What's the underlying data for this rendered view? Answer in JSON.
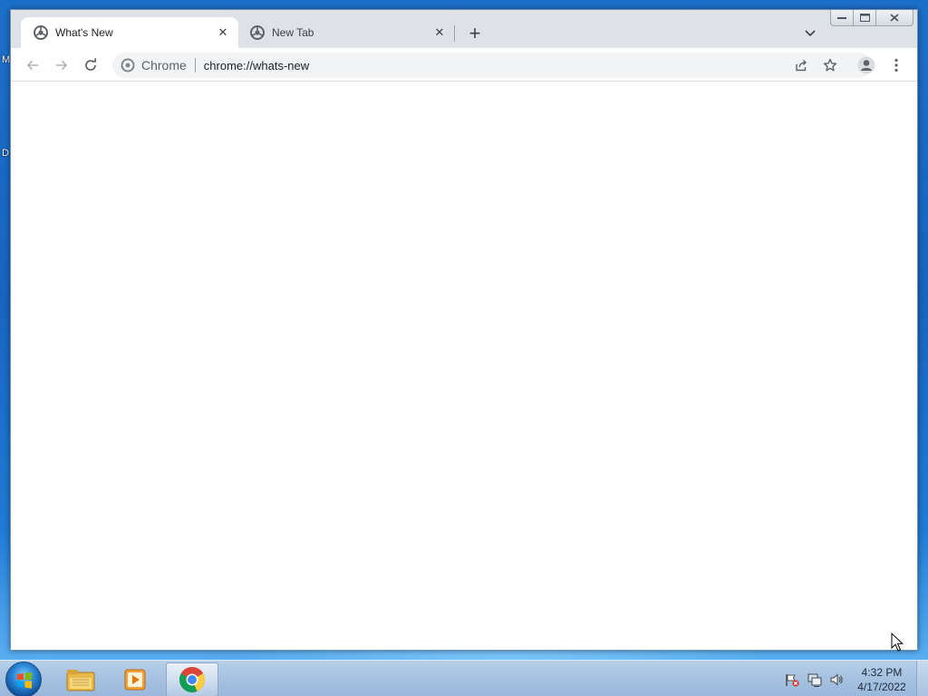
{
  "desktop": {
    "label_m": "M",
    "label_d": "D"
  },
  "browser": {
    "tabs": [
      {
        "title": "What's New",
        "active": true
      },
      {
        "title": "New Tab",
        "active": false
      }
    ],
    "toolbar": {
      "chip_label": "Chrome",
      "url": "chrome://whats-new"
    }
  },
  "taskbar": {
    "clock_time": "4:32 PM",
    "clock_date": "4/17/2022"
  },
  "colors": {
    "chrome_tabstrip": "#dee1e6",
    "omnibox_bg": "#f1f3f4",
    "taskbar": "#a9c4e2",
    "desktop": "#1765c0"
  }
}
